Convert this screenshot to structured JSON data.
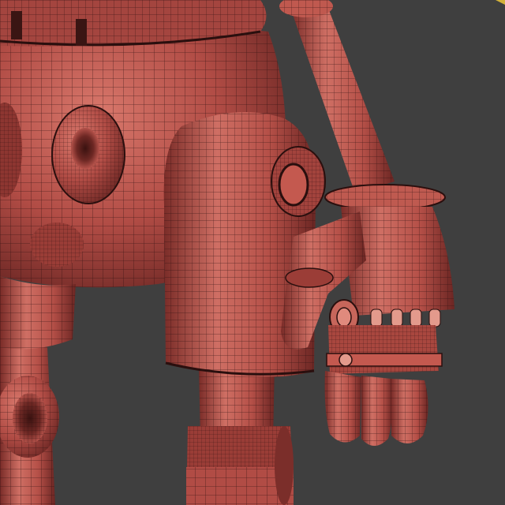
{
  "viewport": {
    "background_color": "#3f3f3f",
    "mesh_base_color": "#b5524a",
    "mesh_highlight_color": "#d97a6f",
    "mesh_shadow_color": "#6f2a26",
    "wireframe_color": "#2a0f0e",
    "accent_top_right": "#d4b23a"
  },
  "model": {
    "parts": [
      "torso",
      "belt",
      "hip-socket-left",
      "hip-socket-right",
      "upper-arm",
      "shoulder-pad",
      "forearm",
      "wrist-ring",
      "hand",
      "thumb",
      "fingers",
      "upper-leg",
      "boot",
      "left-leg",
      "left-knee-joint"
    ]
  }
}
